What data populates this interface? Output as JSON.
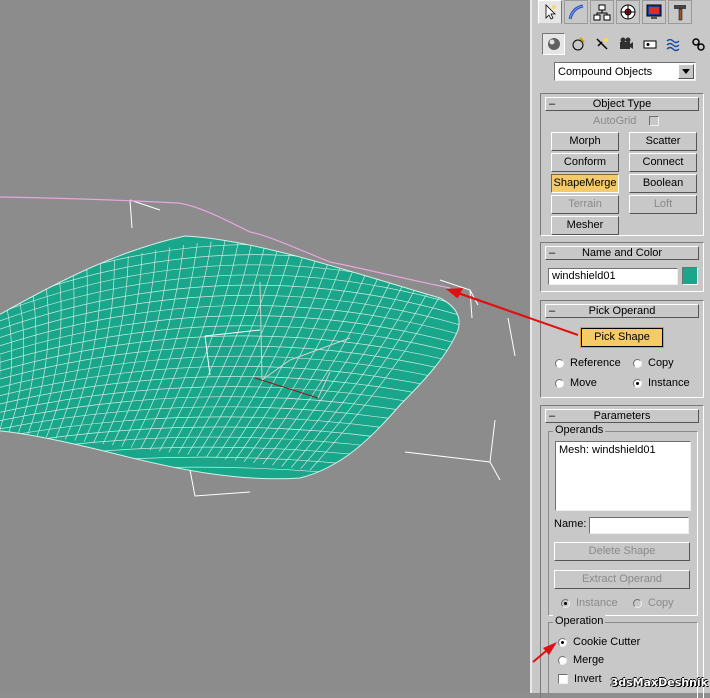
{
  "command_tabs": [
    "create-tab",
    "modify-tab",
    "hierarchy-tab",
    "motion-tab",
    "display-tab",
    "utilities-tab"
  ],
  "category": {
    "selected": "Compound Objects"
  },
  "object_type": {
    "title": "Object Type",
    "autogrid": "AutoGrid",
    "buttons": [
      "Morph",
      "Scatter",
      "Conform",
      "Connect",
      "ShapeMerge",
      "Boolean",
      "Terrain",
      "Loft",
      "Mesher"
    ],
    "active": "ShapeMerge"
  },
  "name_color": {
    "title": "Name and Color",
    "name": "windshield01",
    "color": "#1aa68a"
  },
  "pick_operand": {
    "title": "Pick Operand",
    "button": "Pick Shape",
    "reference": "Reference",
    "copy": "Copy",
    "move": "Move",
    "instance": "Instance",
    "selected": "Instance"
  },
  "parameters": {
    "title": "Parameters",
    "operands_label": "Operands",
    "operands": [
      "Mesh: windshield01"
    ],
    "name_label": "Name:",
    "name_value": "",
    "delete_shape": "Delete Shape",
    "extract_operand": "Extract Operand",
    "instance": "Instance",
    "copy": "Copy"
  },
  "operation": {
    "label": "Operation",
    "cookie_cutter": "Cookie Cutter",
    "merge": "Merge",
    "invert": "Invert",
    "selected": "Cookie Cutter"
  },
  "watermark": "3dsMaxDeshnik",
  "colors": {
    "mesh": "#1aa68a",
    "wire": "#e8f5f0",
    "spline": "#e6a6e0",
    "bbox": "#ffffff",
    "arrow": "#e01010",
    "highlight": "#f4cb66"
  }
}
